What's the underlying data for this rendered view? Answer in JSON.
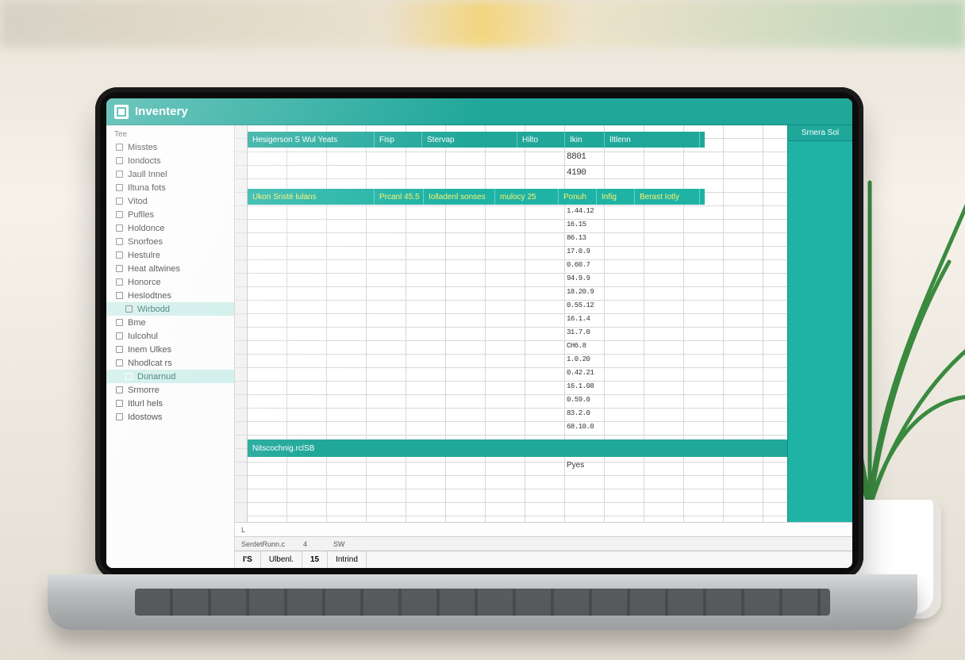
{
  "app": {
    "title": "Inventery"
  },
  "sidebar": {
    "section_label": "Tee",
    "items": [
      {
        "label": "Misstes",
        "active": false
      },
      {
        "label": "Iondocts",
        "active": false
      },
      {
        "label": "Jaull Innel",
        "active": false
      },
      {
        "label": "Iltuna fots",
        "active": false
      },
      {
        "label": "Vitod",
        "active": false
      },
      {
        "label": "Puflles",
        "active": false
      },
      {
        "label": "Holdonce",
        "active": false
      },
      {
        "label": "Snorfoes",
        "active": false
      },
      {
        "label": "Hestulre",
        "active": false
      },
      {
        "label": "Heat altwines",
        "active": false
      },
      {
        "label": "Honorce",
        "active": false
      },
      {
        "label": "Heslodtnes",
        "active": false
      },
      {
        "label": "Wirbodd",
        "active": false,
        "sub": true
      },
      {
        "label": "Bme",
        "active": false
      },
      {
        "label": "Iulcohul",
        "active": false
      },
      {
        "label": "Inem Ulkes",
        "active": false
      },
      {
        "label": "Nhodlcat rs",
        "active": false
      },
      {
        "label": "Dunarnud",
        "active": true,
        "sub": true
      },
      {
        "label": "Srmorre",
        "active": false
      },
      {
        "label": "Itlurl hels",
        "active": false
      },
      {
        "label": "Idostows",
        "active": false
      }
    ]
  },
  "grid": {
    "top_header": {
      "c0": "Hesigerson S Wul Yeats",
      "c1": "Fisp",
      "c2": "Stervap",
      "c3": "Hilto",
      "c4": "Ikin",
      "c5": "Iltlenn"
    },
    "right_header": "Srnera Sol",
    "sub_header": {
      "c0": "Ukon Sristé lulans",
      "c1": "Prcanl 45.5",
      "c2": "Iolladenl sonses",
      "c3": "mulocy 25",
      "c4": "Ponuh",
      "c5": "Infig",
      "c6": "Berast Iotly"
    },
    "summary1": "8801",
    "summary2": "4190",
    "values": [
      "1.44.12",
      "16.15",
      "86.13",
      "17.0.9",
      "0.60.7",
      "94.9.9",
      "18.20.9",
      "0.55.12",
      "16.1.4",
      "31.7.0",
      "CH6.8",
      "1.0.20",
      "0.42.21",
      "16.1.08",
      "0.59.0",
      "83.2.0",
      "68.10.0"
    ],
    "footer_label": "Nitscochnig.rclSB",
    "footer_value": "Pyes"
  },
  "formula_bar": {
    "left": "L",
    "colA": "SerdetRunn.c",
    "colB": "4",
    "colC": "SW"
  },
  "tabs": {
    "t0": "I'S",
    "t1": "Ulbenl.",
    "t2": "15",
    "t3": "Intrind"
  }
}
